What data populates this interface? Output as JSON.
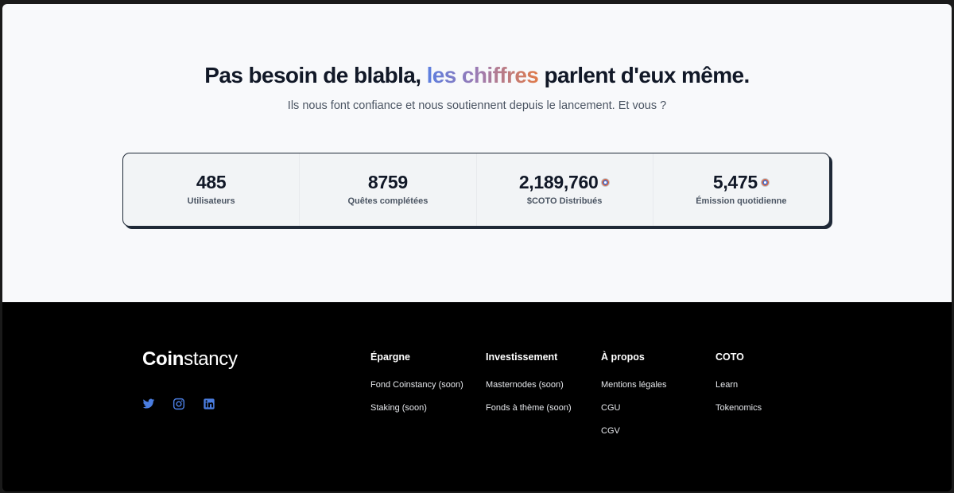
{
  "hero": {
    "headline_before": "Pas besoin de blabla, ",
    "headline_highlight": "les chiffres",
    "headline_after": " parlent d'eux même.",
    "subtitle": "Ils nous font confiance et nous soutiennent depuis le lancement. Et vous ?"
  },
  "stats": [
    {
      "value": "485",
      "label": "Utilisateurs",
      "coin": false
    },
    {
      "value": "8759",
      "label": "Quêtes complétées",
      "coin": false
    },
    {
      "value": "2,189,760",
      "label": "$COTO Distribués",
      "coin": true
    },
    {
      "value": "5,475",
      "label": "Émission quotidienne",
      "coin": true
    }
  ],
  "footer": {
    "logo_bold": "Coin",
    "logo_light": "stancy",
    "socials": [
      "twitter-icon",
      "instagram-icon",
      "linkedin-icon"
    ],
    "columns": [
      {
        "title": "Épargne",
        "links": [
          "Fond Coinstancy (soon)",
          "Staking (soon)"
        ]
      },
      {
        "title": "Investissement",
        "links": [
          "Masternodes (soon)",
          "Fonds à thème (soon)"
        ]
      },
      {
        "title": "À propos",
        "links": [
          "Mentions légales",
          "CGU",
          "CGV"
        ]
      },
      {
        "title": "COTO",
        "links": [
          "Learn",
          "Tokenomics"
        ]
      }
    ]
  },
  "colors": {
    "accent_blue": "#4a7de0",
    "gradient_start": "#5b7fe0",
    "gradient_end": "#e07b4a",
    "hero_bg": "#f8f9fb",
    "footer_bg": "#000000"
  }
}
